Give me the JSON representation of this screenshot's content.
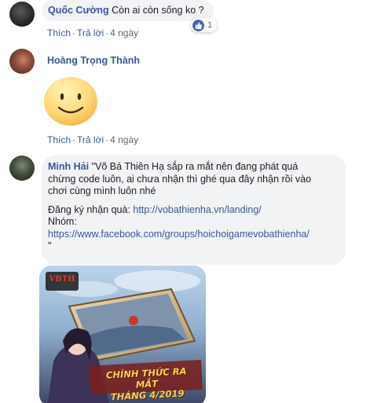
{
  "comments": [
    {
      "author": "Quốc Cường",
      "text": "Còn ai còn sống ko ?",
      "like_count": "1",
      "actions": {
        "like": "Thích",
        "reply": "Trả lời",
        "time": "4 ngày"
      }
    },
    {
      "author": "Hoàng Trọng Thành",
      "sticker": "smiley-face-sticker",
      "actions": {
        "like": "Thích",
        "reply": "Trả lời",
        "time": "4 ngày"
      }
    },
    {
      "author": "Minh Hải",
      "text_line1": "\"Võ Bá Thiên Hạ sắp ra mắt nên đang phát quá",
      "text_line2": "chừng code luôn, ai chưa nhận thì ghé qua đây nhận rồi vào",
      "text_line3": "chơi cùng mình luôn nhé",
      "register_label": "Đăng ký nhận quà: ",
      "register_link": "http://vobathienha.vn/landing/",
      "group_label": "Nhóm:",
      "group_link": "https://www.facebook.com/groups/hoichoigamevobathienha/",
      "closing_quote": "\""
    }
  ],
  "image": {
    "logo_text": "VBTH",
    "banner_line1": "CHÍNH THỨC RA MẮT",
    "banner_line2": "THÁNG 4/2019"
  },
  "colors": {
    "name_blue": "#385898",
    "bubble_bg": "#f2f3f5",
    "like_blue": "#4267b2",
    "meta_gray": "#606770",
    "banner_yellow": "#f7d54a"
  }
}
